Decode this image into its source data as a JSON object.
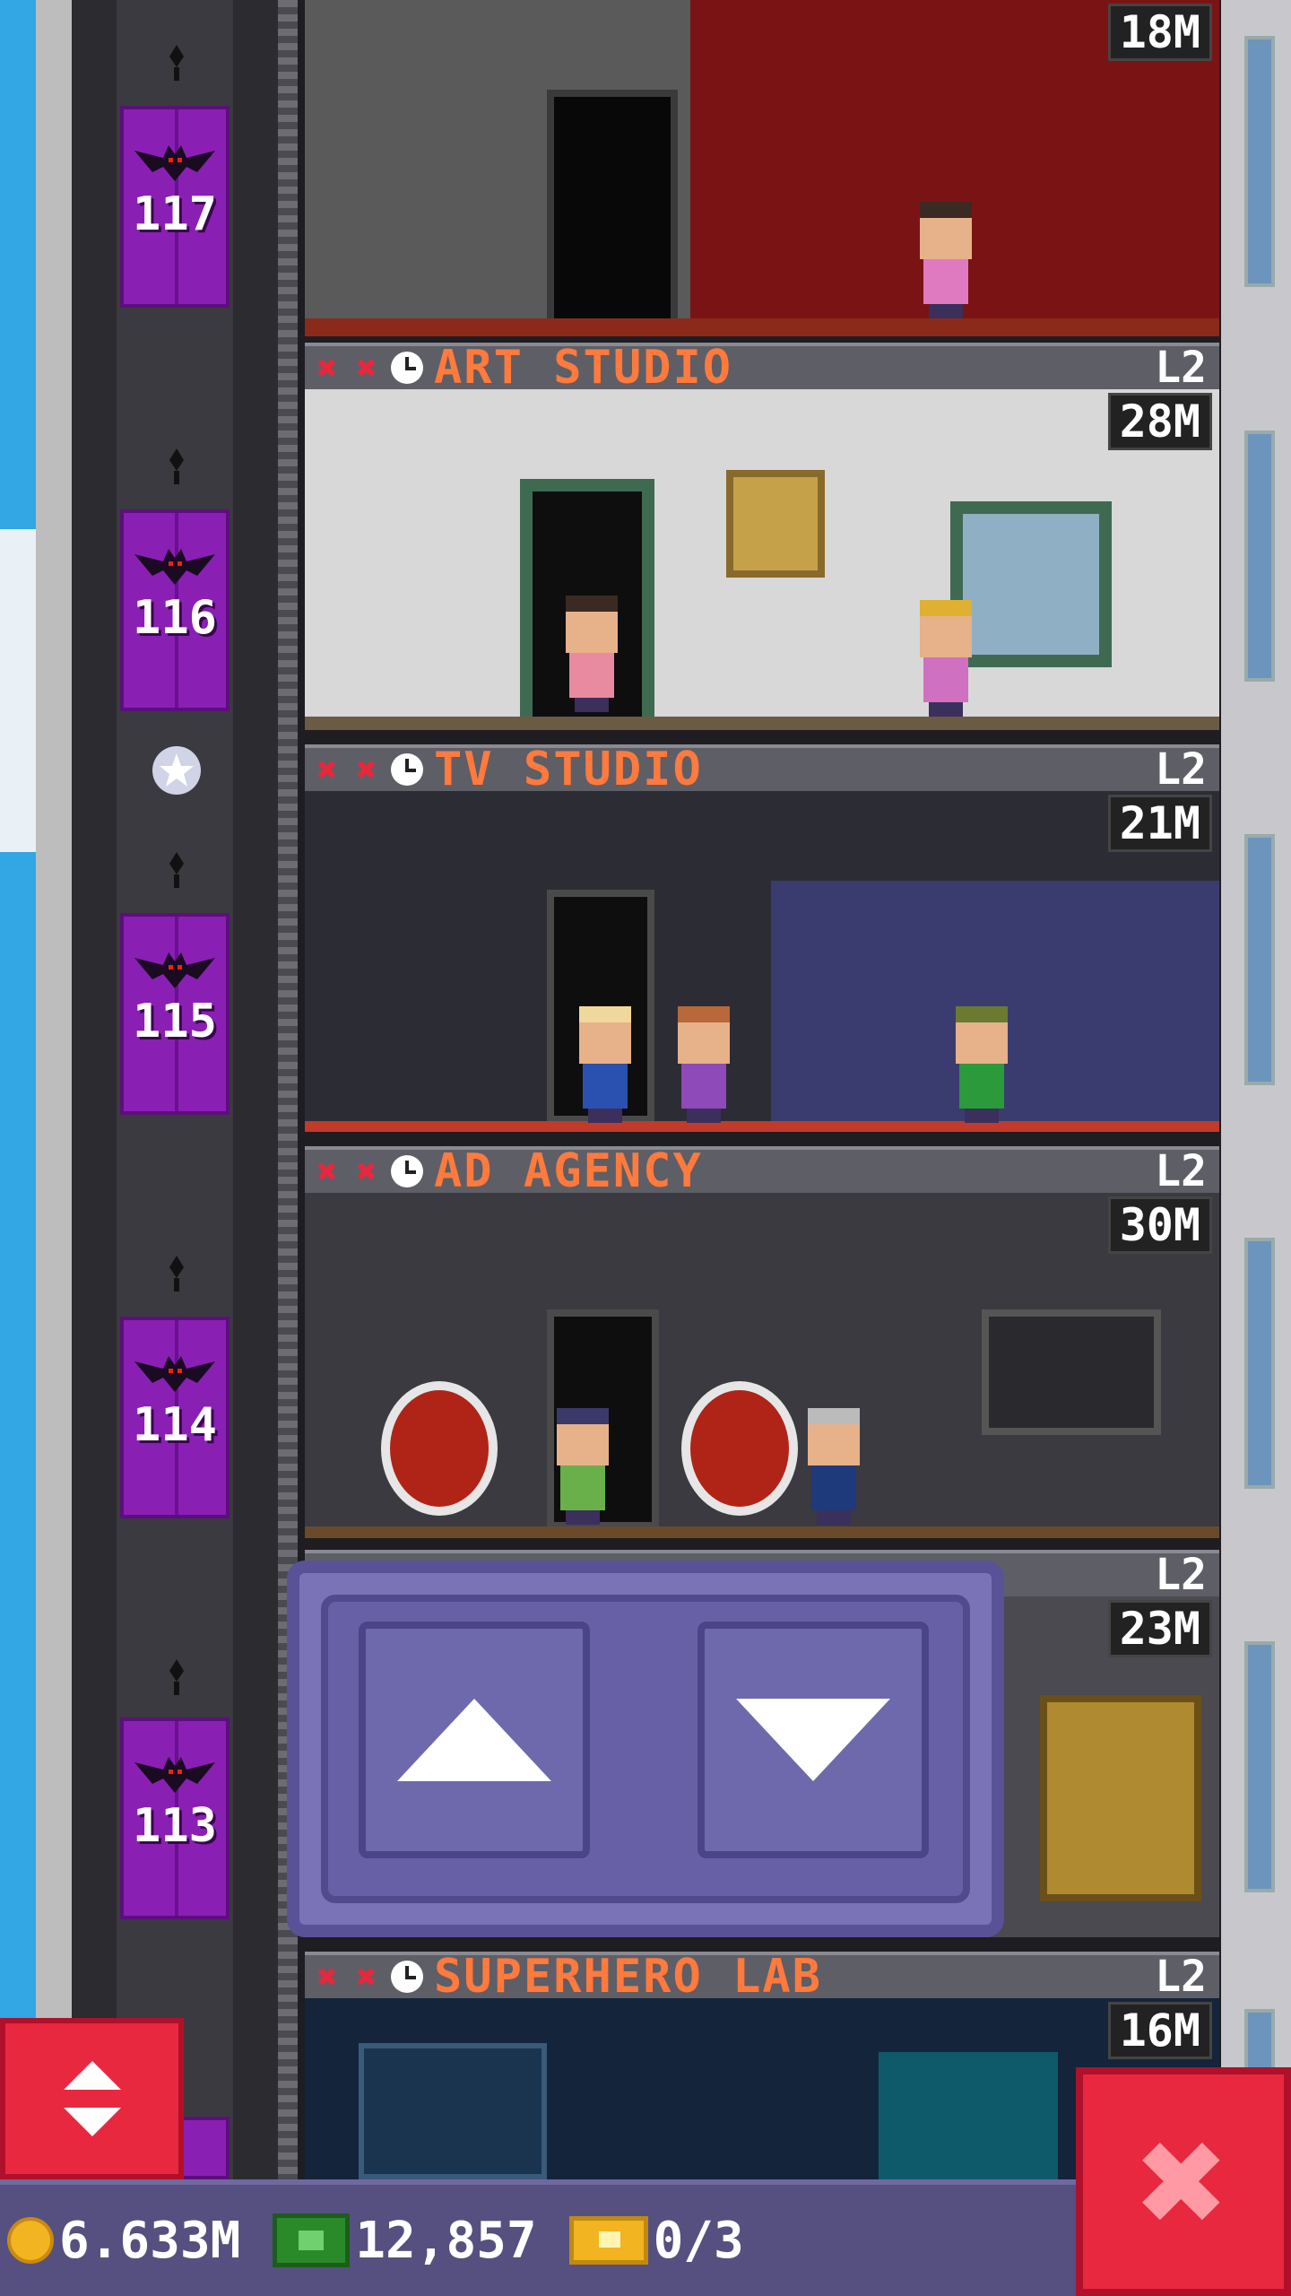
{
  "floors": [
    {
      "name": "",
      "level": "",
      "population": "18M",
      "elevator_floor": "117"
    },
    {
      "name": "ART STUDIO",
      "level": "L2",
      "population": "28M",
      "elevator_floor": "116"
    },
    {
      "name": "TV STUDIO",
      "level": "L2",
      "population": "21M",
      "elevator_floor": "115"
    },
    {
      "name": "AD AGENCY",
      "level": "L2",
      "population": "30M",
      "elevator_floor": "114"
    },
    {
      "name": "",
      "level": "L2",
      "population": "23M",
      "elevator_floor": "113"
    },
    {
      "name": "SUPERHERO LAB",
      "level": "L2",
      "population": "16M",
      "elevator_floor": ""
    }
  ],
  "status_bar": {
    "coins": "6.633M",
    "bux": "12,857",
    "tickets": "0/3"
  },
  "icons": {
    "elevator_button": "up-down-arrows-icon",
    "close_button": "close-icon",
    "coin": "coin-icon",
    "bux": "tower-bux-icon",
    "ticket": "ticket-icon"
  },
  "colors": {
    "accent_orange": "#ff7a3c",
    "elevator_purple": "#8a1fb4",
    "close_red": "#e8283f",
    "panel_purple": "#6760a6"
  }
}
